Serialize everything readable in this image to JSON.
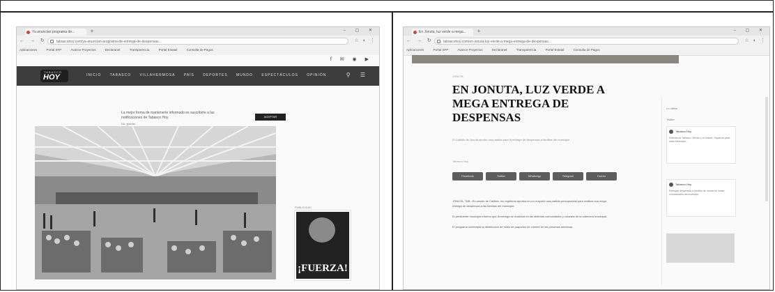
{
  "left": {
    "browser": {
      "tab_title": "Ya anuncian programa de...",
      "url": "tabascohoy.com/ya-anuncian-programa-de-entrega-de-despensas...",
      "bookmarks": [
        "Aplicaciones",
        "Portal SFP",
        "Avance Proyectos",
        "Declaranet",
        "Transparencia",
        "Portal Estatal",
        "Consulta de Pagos"
      ]
    },
    "site": {
      "logo_top": "TABASCO",
      "logo_main": "HOY",
      "menu": [
        "INICIO",
        "TABASCO",
        "VILLAHERMOSA",
        "PAÍS",
        "DEPORTES",
        "MUNDO",
        "ESPECTÁCULOS",
        "OPINIÓN"
      ],
      "notice_text": "La mejor forma de mantenerte informado es suscribirte a las notificaciones de Tabasco Hoy",
      "notice_button": "ACEPTAR",
      "notice_link": "No, gracias",
      "ad_label": "PUBLICIDAD",
      "ad_text": "¡FUERZA!"
    }
  },
  "right": {
    "browser": {
      "tab_title": "En Jonuta, luz verde a mega...",
      "url": "tabascohoy.com/en-jonuta-luz-verde-a-mega-entrega-de-despensas...",
      "bookmarks": [
        "Aplicaciones",
        "Portal SFP",
        "Avance Proyectos",
        "Declaranet",
        "Transparencia",
        "Portal Estatal",
        "Consulta de Pagos"
      ]
    },
    "article": {
      "section": "JONUTA",
      "headline": "EN JONUTA, LUZ VERDE A MEGA ENTREGA DE DESPENSAS",
      "summary": "El Cabildo de Jonuta aprobó una partida para la entrega de despensas a familias del municipio",
      "byline": "Tabasco Hoy",
      "share_buttons": [
        "Facebook",
        "Twitter",
        "WhatsApp",
        "Telegram",
        "Correo"
      ],
      "paragraphs": [
        "JONUTA, TAB.- En sesión de Cabildo, los regidores aprobaron por mayoría una partida presupuestal para realizar una mega entrega de despensas a las familias del municipio.",
        "El presidente municipal informó que la entrega se realizará en las distintas comunidades y colonias de la cabecera municipal.",
        "El programa contempla la distribución de miles de paquetes de víveres en las próximas semanas."
      ]
    },
    "sidebar": {
      "label": "Lo último",
      "tab": "Twitter",
      "cards": [
        {
          "name": "Tabasco Hoy",
          "text": "Noticias de Tabasco, México y el mundo. Síguenos para estar informado."
        },
        {
          "name": "Tabasco Hoy",
          "text": "Entregan despensas a familias de Jonuta en varias comunidades del municipio."
        }
      ]
    }
  }
}
